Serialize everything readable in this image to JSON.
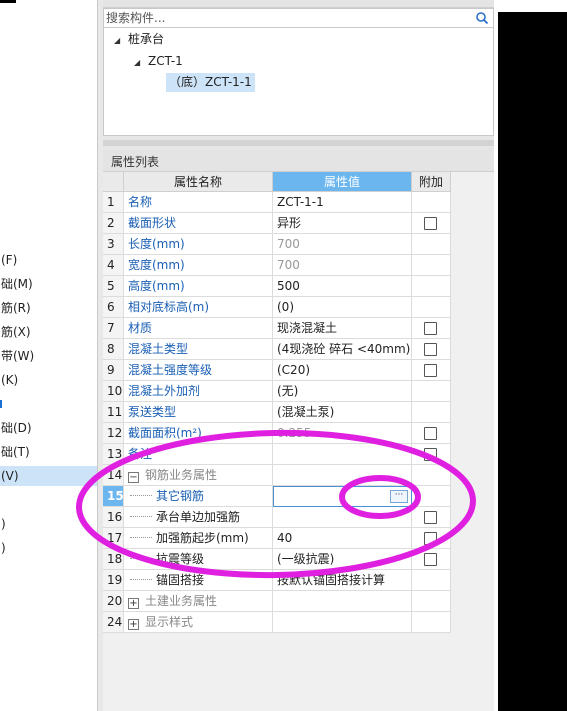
{
  "left_panel": {
    "items": [
      {
        "label": "(F)",
        "selected": false
      },
      {
        "label": "础(M)",
        "selected": false
      },
      {
        "label": "筋(R)",
        "selected": false
      },
      {
        "label": "筋(X)",
        "selected": false
      },
      {
        "label": "带(W)",
        "selected": false
      },
      {
        "label": "(K)",
        "selected": false
      },
      {
        "label": "础(D)",
        "selected": false
      },
      {
        "label": "础(T)",
        "selected": false
      },
      {
        "label": "(V)",
        "selected": true
      },
      {
        "label": ")",
        "selected": false
      },
      {
        "label": ")",
        "selected": false
      }
    ]
  },
  "search": {
    "placeholder": "搜索构件...",
    "icon": "search-icon"
  },
  "tree": {
    "root": "桩承台",
    "child": "ZCT-1",
    "leaf": "（底）ZCT-1-1"
  },
  "properties": {
    "title": "属性列表",
    "headers": {
      "name": "属性名称",
      "value": "属性值",
      "extra": "附加"
    },
    "rows": [
      {
        "num": "1",
        "name": "名称",
        "value": "ZCT-1-1",
        "checkbox": false
      },
      {
        "num": "2",
        "name": "截面形状",
        "value": "异形",
        "checkbox": true
      },
      {
        "num": "3",
        "name": "长度(mm)",
        "value": "700",
        "checkbox": false
      },
      {
        "num": "4",
        "name": "宽度(mm)",
        "value": "700",
        "checkbox": false
      },
      {
        "num": "5",
        "name": "高度(mm)",
        "value": "500",
        "checkbox": false
      },
      {
        "num": "6",
        "name": "相对底标高(m)",
        "value": "(0)",
        "checkbox": false
      },
      {
        "num": "7",
        "name": "材质",
        "value": "现浇混凝土",
        "checkbox": true
      },
      {
        "num": "8",
        "name": "混凝土类型",
        "value": "(4现浇砼 碎石 <40mm)",
        "checkbox": true
      },
      {
        "num": "9",
        "name": "混凝土强度等级",
        "value": "(C20)",
        "checkbox": true
      },
      {
        "num": "10",
        "name": "混凝土外加剂",
        "value": "(无)",
        "checkbox": false
      },
      {
        "num": "11",
        "name": "泵送类型",
        "value": "(混凝土泵)",
        "checkbox": false
      },
      {
        "num": "12",
        "name": "截面面积(m²)",
        "value": "0.255",
        "checkbox": true
      },
      {
        "num": "13",
        "name": "备注",
        "value": "",
        "checkbox": true
      },
      {
        "num": "14",
        "name": "钢筋业务属性",
        "value": "",
        "checkbox": false
      },
      {
        "num": "15",
        "name": "其它钢筋",
        "value": "",
        "checkbox": false
      },
      {
        "num": "16",
        "name": "承台单边加强筋",
        "value": "",
        "checkbox": true
      },
      {
        "num": "17",
        "name": "加强筋起步(mm)",
        "value": "40",
        "checkbox": true
      },
      {
        "num": "18",
        "name": "抗震等级",
        "value": "(一级抗震)",
        "checkbox": true
      },
      {
        "num": "19",
        "name": "锚固搭接",
        "value": "按默认锚固搭接计算",
        "checkbox": false
      },
      {
        "num": "20",
        "name": "土建业务属性",
        "value": "",
        "checkbox": false
      },
      {
        "num": "24",
        "name": "显示样式",
        "value": "",
        "checkbox": false
      }
    ],
    "ellipsis_label": "···",
    "collapse_symbol": "−",
    "expand_symbol": "+"
  },
  "colors": {
    "header_active": "#6cb6f0",
    "annotation": "#e020e0",
    "selection": "#cde3f7",
    "link_text": "#1a5fb4"
  }
}
